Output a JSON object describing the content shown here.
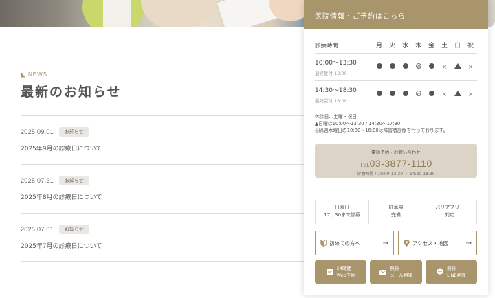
{
  "news": {
    "eyebrow": "NEWS",
    "title": "最新のお知らせ",
    "items": [
      {
        "date": "2025.09.01",
        "category": "お知らせ",
        "text": "2025年9月の診療日について"
      },
      {
        "date": "2025.07.31",
        "category": "お知らせ",
        "text": "2025年8月の診療日について"
      },
      {
        "date": "2025.07.01",
        "category": "お知らせ",
        "text": "2025年7月の診療日について"
      }
    ]
  },
  "panel": {
    "header": "医院情報・ご予約はこちら",
    "schedule": {
      "label": "診療時間",
      "days": [
        "月",
        "火",
        "水",
        "木",
        "金",
        "土",
        "日",
        "祝"
      ],
      "rows": [
        {
          "time": "10:00〜13:30",
          "last": "最終受付 13:00",
          "marks": [
            "dot",
            "dot",
            "dot",
            "ring",
            "dot",
            "x",
            "tri",
            "x"
          ]
        },
        {
          "time": "14:30〜18:30",
          "last": "最終受付 18:00",
          "marks": [
            "dot",
            "dot",
            "dot",
            "ring",
            "dot",
            "x",
            "tri",
            "x"
          ]
        }
      ]
    },
    "notes": [
      "休診日…土曜・祝日",
      "▲日曜は10:00〜13:30 / 14:30〜17:30",
      "◎隔週木曜日の10:00〜16:00は障害者診療を行っております。"
    ],
    "call": {
      "label": "電話予約・お問い合わせ",
      "tel_prefix": "TEL",
      "tel": "03-3877-1110",
      "hours": "診療時間 / 10:00-13:30 ・ 14:30-18:30"
    },
    "features": [
      {
        "line1": "日曜日",
        "line2": "17：30まで診療"
      },
      {
        "line1": "駐車場",
        "line2": "完備"
      },
      {
        "line1": "バリアフリー",
        "line2": "対応"
      }
    ],
    "buttons": {
      "first_visit": "初めての方へ",
      "access": "アクセス・地図",
      "arrow": "→"
    },
    "actions": [
      {
        "line1": "24時間",
        "line2": "Web予約",
        "icon": "calendar-icon"
      },
      {
        "line1": "無料",
        "line2": "メール相談",
        "icon": "mail-icon"
      },
      {
        "line1": "無料",
        "line2": "LINE相談",
        "icon": "chat-icon"
      }
    ],
    "accent_color": "#a8956c"
  }
}
